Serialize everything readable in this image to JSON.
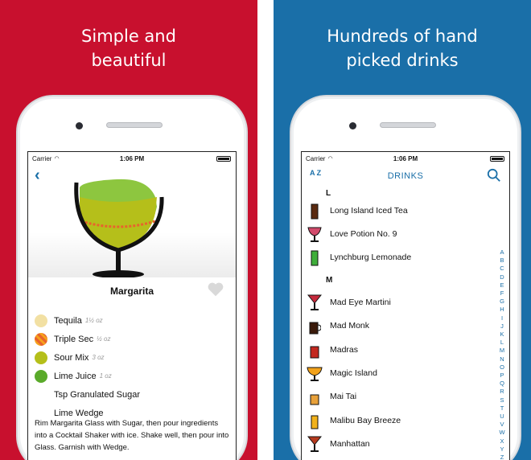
{
  "left_panel": {
    "background": "#c8102e",
    "headline_line1": "Simple and",
    "headline_line2": "beautiful",
    "status": {
      "carrier": "Carrier",
      "time": "1:06 PM"
    },
    "back_label": "‹",
    "drink": {
      "name": "Margarita",
      "glass_color": "#8dc63f"
    },
    "ingredients": [
      {
        "name": "Tequila",
        "amount": "1½ oz",
        "color": "#f2e0a3"
      },
      {
        "name": "Triple Sec",
        "amount": "½ oz",
        "color": "#e8642c"
      },
      {
        "name": "Sour Mix",
        "amount": "3 oz",
        "color": "#b5bf1a"
      },
      {
        "name": "Lime Juice",
        "amount": "1 oz",
        "color": "#5aaa2a"
      },
      {
        "name": "Tsp Granulated Sugar",
        "amount": "",
        "color": ""
      },
      {
        "name": "Lime Wedge",
        "amount": "",
        "color": ""
      }
    ],
    "directions": "Rim Margarita Glass with Sugar, then pour ingredients into a Cocktail Shaker with ice. Shake well, then pour into Glass. Garnish with Wedge."
  },
  "right_panel": {
    "background": "#1a6fa8",
    "headline_line1": "Hundreds of hand",
    "headline_line2": "picked drinks",
    "status": {
      "carrier": "Carrier",
      "time": "1:06 PM"
    },
    "nav": {
      "sort_label": "A Z",
      "title": "DRINKS"
    },
    "sections": {
      "L": [
        "Long Island Iced Tea",
        "Love Potion No. 9",
        "Lynchburg Lemonade"
      ],
      "M": [
        "Mad Eye Martini",
        "Mad Monk",
        "Madras",
        "Magic Island",
        "Mai Tai",
        "Malibu Bay Breeze",
        "Manhattan"
      ]
    },
    "section_L": "L",
    "section_M": "M",
    "index_letters": "A B C D E F G H I J K L M N O P Q R S T U V W X Y Z"
  }
}
